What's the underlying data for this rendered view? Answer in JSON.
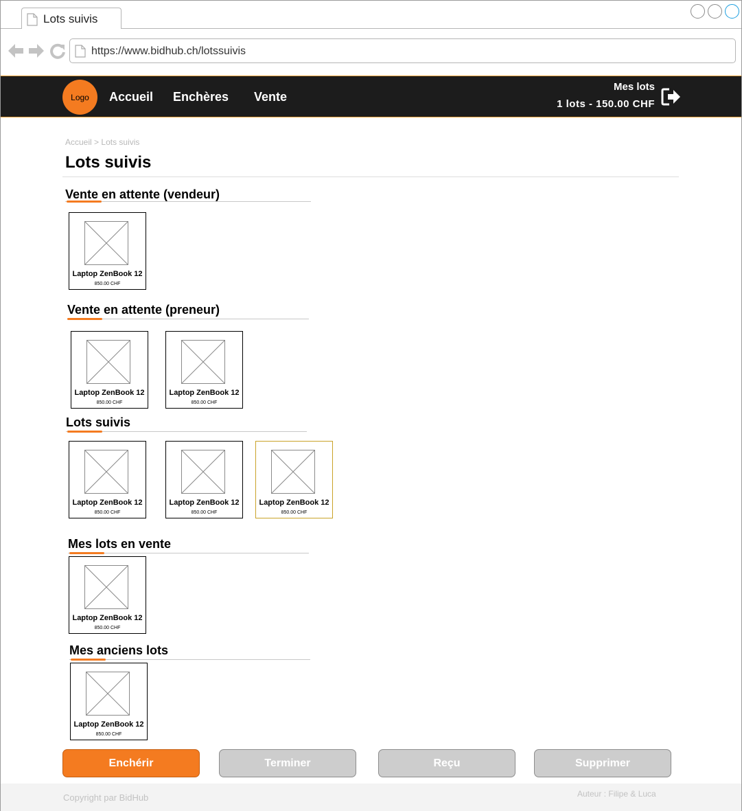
{
  "browser": {
    "tab_title": "Lots suivis",
    "url": "https://www.bidhub.ch/lotssuivis"
  },
  "header": {
    "logo": "Logo",
    "menu": [
      "Accueil",
      "Enchères",
      "Vente"
    ],
    "cart": {
      "title": "Mes lots",
      "total": "1 lots - 150.00 CHF"
    }
  },
  "breadcrumb": {
    "home": "Accueil",
    "separator": ">",
    "current": "Lots suivis"
  },
  "page_title": "Lots suivis",
  "sections": [
    {
      "title": "Vente en attente (vendeur)",
      "items": [
        {
          "name": "Laptop ZenBook 12",
          "price": "850.00 CHF"
        }
      ]
    },
    {
      "title": "Vente en attente (preneur)",
      "items": [
        {
          "name": "Laptop ZenBook 12",
          "price": "850.00 CHF"
        },
        {
          "name": "Laptop ZenBook 12",
          "price": "850.00 CHF"
        }
      ]
    },
    {
      "title": "Lots suivis",
      "items": [
        {
          "name": "Laptop ZenBook 12",
          "price": "850.00 CHF"
        },
        {
          "name": "Laptop ZenBook 12",
          "price": "850.00 CHF"
        },
        {
          "name": "Laptop ZenBook 12",
          "price": "850.00 CHF",
          "selected": true
        }
      ]
    },
    {
      "title": "Mes lots en vente",
      "items": [
        {
          "name": "Laptop ZenBook 12",
          "price": "850.00 CHF"
        }
      ]
    },
    {
      "title": "Mes anciens lots",
      "items": [
        {
          "name": "Laptop ZenBook 12",
          "price": "850.00 CHF"
        }
      ]
    }
  ],
  "actions": {
    "bid": "Enchérir",
    "finish": "Terminer",
    "received": "Reçu",
    "delete": "Supprimer"
  },
  "footer": {
    "copyright": "Copyright par BidHub",
    "author": "Auteur : Filipe & Luca"
  },
  "colors": {
    "accent": "#f47b20",
    "header_bg": "#1c1c1c",
    "button_disabled": "#cdcdcd",
    "selected_border": "#c9a227"
  },
  "icons": {
    "tab": "document-icon",
    "back": "arrow-left-icon",
    "forward": "arrow-right-icon",
    "reload": "reload-icon",
    "logout": "logout-icon",
    "placeholder": "image-placeholder-icon"
  }
}
